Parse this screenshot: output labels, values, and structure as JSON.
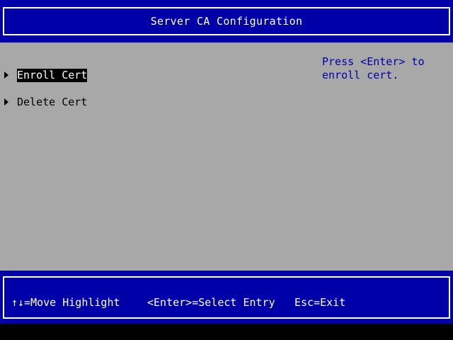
{
  "header": {
    "title": "Server CA Configuration"
  },
  "menu": {
    "items": [
      {
        "label": "Enroll Cert",
        "selected": true
      },
      {
        "label": "Delete Cert",
        "selected": false
      }
    ]
  },
  "help": {
    "text": "Press <Enter> to\nenroll cert."
  },
  "footer": {
    "move_hint": "↑↓=Move Highlight",
    "enter_hint": "<Enter>=Select Entry",
    "esc_hint": "Esc=Exit"
  },
  "colors": {
    "header_bg": "#0000a8",
    "main_bg": "#a8a8a8",
    "help_text": "#0000a8",
    "highlight_bg": "#000000",
    "highlight_text": "#ffffff"
  }
}
